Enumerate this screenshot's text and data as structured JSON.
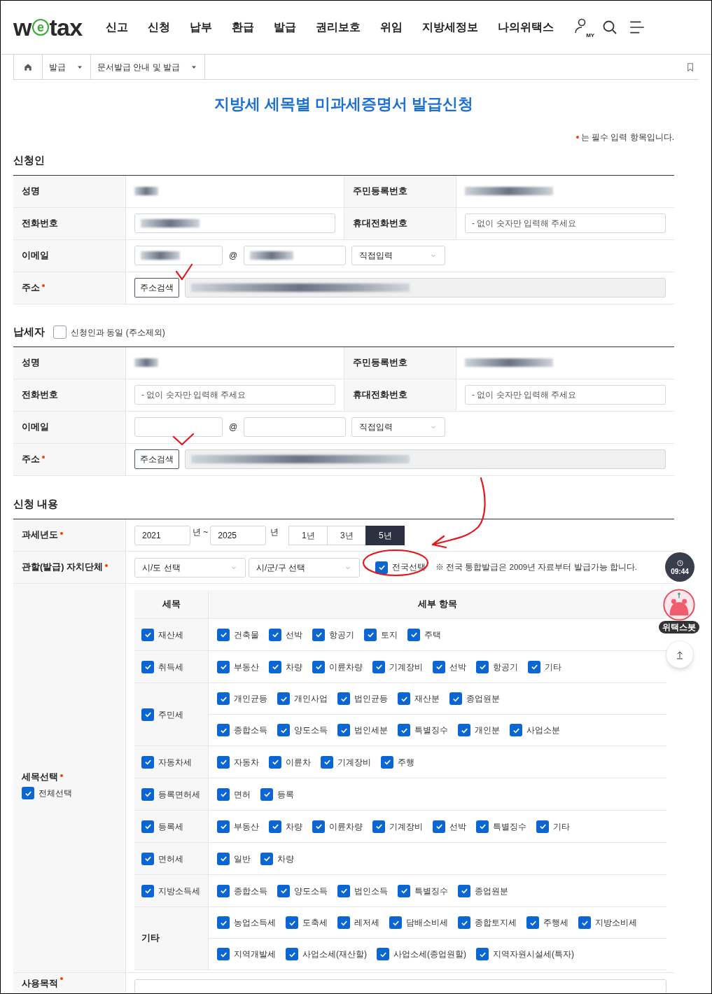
{
  "header": {
    "logo": "wetax",
    "menu": [
      "신고",
      "신청",
      "납부",
      "환급",
      "발급",
      "권리보호",
      "위임",
      "지방세정보",
      "나의위택스"
    ],
    "my_badge": "MY"
  },
  "breadcrumb": [
    {
      "label": "발급"
    },
    {
      "label": "문서발급 안내 및 발급"
    }
  ],
  "title": "지방세 세목별 미과세증명서 발급신청",
  "required_note": "는 필수 입력 항목입니다.",
  "applicant": {
    "heading": "신청인",
    "rows": [
      [
        {
          "label": "성명",
          "field": {
            "kind": "static",
            "redacted": true
          }
        },
        {
          "label": "주민등록번호",
          "field": {
            "kind": "static",
            "redacted": true
          }
        }
      ],
      [
        {
          "label": "전화번호",
          "field": {
            "kind": "input",
            "redacted": true
          }
        },
        {
          "label": "휴대전화번호",
          "field": {
            "kind": "input",
            "placeholder": "- 없이 숫자만 입력해 주세요"
          }
        }
      ],
      [
        {
          "label": "이메일",
          "field": {
            "kind": "email",
            "user_redacted": true,
            "domain_redacted": true,
            "at": "@",
            "select": "직접입력"
          }
        }
      ],
      [
        {
          "label": "주소",
          "required": true,
          "field": {
            "kind": "address",
            "button": "주소검색",
            "redacted": true
          }
        }
      ]
    ]
  },
  "taxpayer": {
    "heading": "납세자",
    "same_as": {
      "label": "신청인과 동일 (주소제외)",
      "checked": false
    },
    "rows": [
      [
        {
          "label": "성명",
          "field": {
            "kind": "static",
            "redacted": true
          }
        },
        {
          "label": "주민등록번호",
          "field": {
            "kind": "static",
            "redacted": true
          }
        }
      ],
      [
        {
          "label": "전화번호",
          "field": {
            "kind": "input",
            "placeholder": "- 없이 숫자만 입력해 주세요"
          }
        },
        {
          "label": "휴대전화번호",
          "field": {
            "kind": "input",
            "placeholder": "- 없이 숫자만 입력해 주세요"
          }
        }
      ],
      [
        {
          "label": "이메일",
          "field": {
            "kind": "email",
            "user_redacted": false,
            "domain_redacted": false,
            "at": "@",
            "select": "직접입력"
          }
        }
      ],
      [
        {
          "label": "주소",
          "required": true,
          "field": {
            "kind": "address",
            "button": "주소검색",
            "redacted": true
          }
        }
      ]
    ]
  },
  "request": {
    "heading": "신청 내용",
    "tax_year": {
      "label": "과세년도",
      "required": true,
      "from": "2021",
      "from_unit": "년 ~",
      "to": "2025",
      "to_unit": "년",
      "periods": [
        {
          "label": "1년",
          "selected": false
        },
        {
          "label": "3년",
          "selected": false
        },
        {
          "label": "5년",
          "selected": true
        }
      ]
    },
    "jurisdiction": {
      "label": "관할(발급) 자치단체",
      "required": true,
      "selects": [
        "시/도 선택",
        "시/군/구 선택"
      ],
      "nationwide": {
        "label": "전국선택",
        "checked": true
      },
      "note": "※ 전국 통합발급은 2009년 자료부터 발급가능 합니다."
    },
    "tax_items": {
      "label": "세목선택",
      "required": true,
      "select_all": {
        "label": "전체선택",
        "checked": true
      },
      "columns": [
        "세목",
        "세부 항목"
      ],
      "rows": [
        {
          "kind": "checkable",
          "name": "재산세",
          "checked": true,
          "lines": [
            [
              {
                "label": "건축물",
                "checked": true
              },
              {
                "label": "선박",
                "checked": true
              },
              {
                "label": "항공기",
                "checked": true
              },
              {
                "label": "토지",
                "checked": true
              },
              {
                "label": "주택",
                "checked": true
              }
            ]
          ]
        },
        {
          "kind": "checkable",
          "name": "취득세",
          "checked": true,
          "lines": [
            [
              {
                "label": "부동산",
                "checked": true
              },
              {
                "label": "차량",
                "checked": true
              },
              {
                "label": "이륜차량",
                "checked": true
              },
              {
                "label": "기계장비",
                "checked": true
              },
              {
                "label": "선박",
                "checked": true
              },
              {
                "label": "항공기",
                "checked": true
              },
              {
                "label": "기타",
                "checked": true
              }
            ]
          ]
        },
        {
          "kind": "checkable",
          "name": "주민세",
          "checked": true,
          "lines": [
            [
              {
                "label": "개인균등",
                "checked": true
              },
              {
                "label": "개인사업",
                "checked": true
              },
              {
                "label": "법인균등",
                "checked": true
              },
              {
                "label": "재산분",
                "checked": true
              },
              {
                "label": "종업원분",
                "checked": true
              }
            ],
            [
              {
                "label": "종합소득",
                "checked": true
              },
              {
                "label": "양도소득",
                "checked": true
              },
              {
                "label": "법인세분",
                "checked": true
              },
              {
                "label": "특별징수",
                "checked": true
              },
              {
                "label": "개인분",
                "checked": true
              },
              {
                "label": "사업소분",
                "checked": true
              }
            ]
          ]
        },
        {
          "kind": "checkable",
          "name": "자동차세",
          "checked": true,
          "lines": [
            [
              {
                "label": "자동차",
                "checked": true
              },
              {
                "label": "이륜차",
                "checked": true
              },
              {
                "label": "기계장비",
                "checked": true
              },
              {
                "label": "주행",
                "checked": true
              }
            ]
          ]
        },
        {
          "kind": "checkable",
          "name": "등록면허세",
          "checked": true,
          "lines": [
            [
              {
                "label": "면허",
                "checked": true
              },
              {
                "label": "등록",
                "checked": true
              }
            ]
          ]
        },
        {
          "kind": "checkable",
          "name": "등록세",
          "checked": true,
          "lines": [
            [
              {
                "label": "부동산",
                "checked": true
              },
              {
                "label": "차량",
                "checked": true
              },
              {
                "label": "이륜차량",
                "checked": true
              },
              {
                "label": "기계장비",
                "checked": true
              },
              {
                "label": "선박",
                "checked": true
              },
              {
                "label": "특별징수",
                "checked": true
              },
              {
                "label": "기타",
                "checked": true
              }
            ]
          ]
        },
        {
          "kind": "checkable",
          "name": "면허세",
          "checked": true,
          "lines": [
            [
              {
                "label": "일반",
                "checked": true
              },
              {
                "label": "차량",
                "checked": true
              }
            ]
          ]
        },
        {
          "kind": "checkable",
          "name": "지방소득세",
          "checked": true,
          "lines": [
            [
              {
                "label": "종합소득",
                "checked": true
              },
              {
                "label": "양도소득",
                "checked": true
              },
              {
                "label": "법인소득",
                "checked": true
              },
              {
                "label": "특별징수",
                "checked": true
              },
              {
                "label": "종업원분",
                "checked": true
              }
            ]
          ]
        },
        {
          "kind": "group",
          "name": "기타",
          "lines": [
            [
              {
                "label": "농업소득세",
                "checked": true
              },
              {
                "label": "도축세",
                "checked": true
              },
              {
                "label": "레저세",
                "checked": true
              },
              {
                "label": "담배소비세",
                "checked": true
              },
              {
                "label": "종합토지세",
                "checked": true
              },
              {
                "label": "주행세",
                "checked": true
              },
              {
                "label": "지방소비세",
                "checked": true
              }
            ],
            [
              {
                "label": "지역개발세",
                "checked": true
              },
              {
                "label": "사업소세(재산할)",
                "checked": true
              },
              {
                "label": "사업소세(종업원할)",
                "checked": true
              },
              {
                "label": "지역자원시설세(특자)",
                "checked": true
              }
            ]
          ]
        }
      ]
    },
    "purpose": {
      "label": "사용목적",
      "required": true
    }
  },
  "side": {
    "timer": "09:44",
    "chatbot": "위택스봇"
  },
  "annotations": [
    {
      "kind": "check"
    },
    {
      "kind": "check"
    },
    {
      "kind": "arrow"
    },
    {
      "kind": "circle"
    }
  ]
}
